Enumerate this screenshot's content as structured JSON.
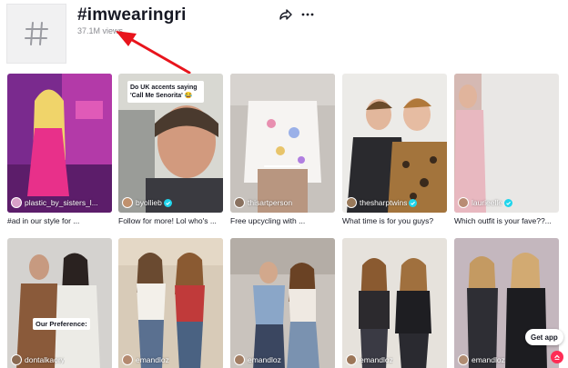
{
  "header": {
    "title": "#imwearingri",
    "views": "37.1M views"
  },
  "icons": {
    "hashtag": "hashtag-icon",
    "share": "share-icon",
    "more": "more-options-icon",
    "verified": "verified-badge-icon",
    "scroll_top": "arrow-up-icon"
  },
  "annotation": {
    "arrow_color": "#e8141c"
  },
  "colors": {
    "verified": "#20d5ec",
    "accent": "#fe2c55"
  },
  "videos": [
    {
      "author": "plastic_by_sisters_l...",
      "caption": "#ad in our style for ...",
      "verified": false,
      "overlay": ""
    },
    {
      "author": "byollieb",
      "caption": "Follow for more! Lol who's ...",
      "verified": true,
      "overlay": "Do UK accents saying 'Call Me Senorita' 😂"
    },
    {
      "author": "thisartperson",
      "caption": "Free upcycling with ...",
      "verified": false,
      "overlay": ""
    },
    {
      "author": "thesharptwins",
      "caption": "What time is for you guys?",
      "verified": true,
      "overlay": ""
    },
    {
      "author": "laurieelle",
      "caption": "Which outfit is your fave??...",
      "verified": true,
      "overlay": ""
    },
    {
      "author": "dontalkaory",
      "caption": "",
      "verified": false,
      "overlay": "Our Preference:"
    },
    {
      "author": "emandloz",
      "caption": "",
      "verified": false,
      "overlay": ""
    },
    {
      "author": "emandloz",
      "caption": "",
      "verified": false,
      "overlay": ""
    },
    {
      "author": "emandloz",
      "caption": "",
      "verified": false,
      "overlay": ""
    },
    {
      "author": "emandloz",
      "caption": "",
      "verified": false,
      "overlay": ""
    }
  ],
  "get_app": "Get app"
}
